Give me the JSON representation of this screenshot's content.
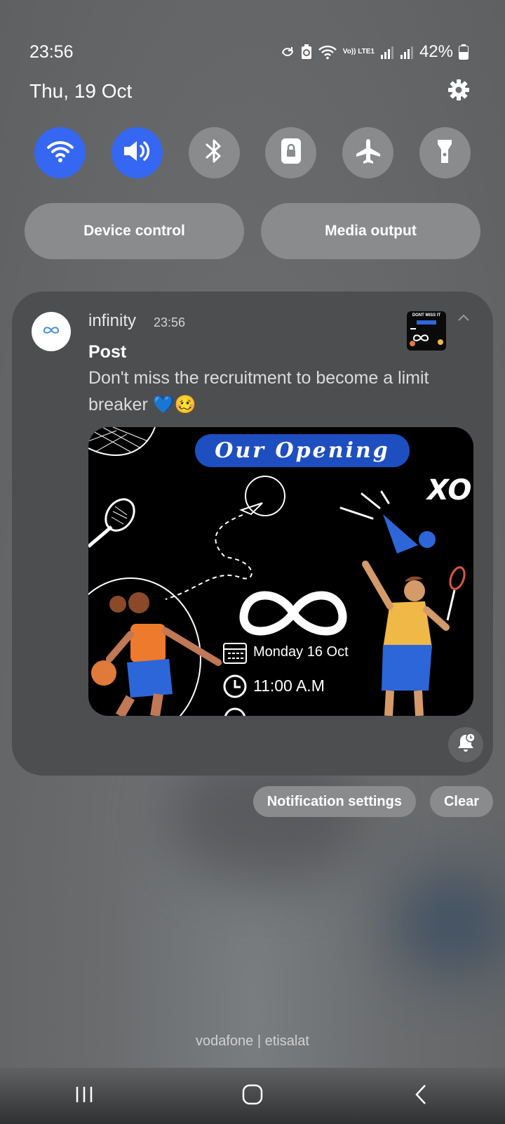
{
  "status_bar": {
    "time": "23:56",
    "battery": "42%",
    "icons": [
      "sync-icon",
      "battery-saver-icon",
      "wifi-icon",
      "volte-icon",
      "signal-icon",
      "signal-icon",
      "battery-icon"
    ],
    "volte_label": "Vo)) LTE1"
  },
  "quick_panel": {
    "date": "Thu, 19 Oct",
    "settings_icon": "gear-icon",
    "toggles": [
      {
        "name": "wifi",
        "icon": "wifi-icon",
        "on": true
      },
      {
        "name": "sound",
        "icon": "volume-icon",
        "on": true
      },
      {
        "name": "bluetooth",
        "icon": "bluetooth-icon",
        "on": false
      },
      {
        "name": "rotation-lock",
        "icon": "lock-icon",
        "on": false
      },
      {
        "name": "airplane-mode",
        "icon": "airplane-icon",
        "on": false
      },
      {
        "name": "flashlight",
        "icon": "flashlight-icon",
        "on": false
      }
    ],
    "device_control_label": "Device control",
    "media_output_label": "Media output"
  },
  "notification": {
    "app_name": "infinity",
    "time": "23:56",
    "title": "Post",
    "body": "Don't miss the recruitment to become a limit breaker 💙🥴",
    "thumbnail_text": "DONT MISS IT",
    "image": {
      "heading": "Our Opening",
      "date_text": "Monday 16 Oct",
      "time_text": "11:00 A.M"
    }
  },
  "actions": {
    "notification_settings": "Notification settings",
    "clear": "Clear"
  },
  "carrier": "vodafone | etisalat",
  "colors": {
    "accent": "#3567f2",
    "tile": "#8a8b8d",
    "card": "#4d4e50",
    "banner": "#1e4fc0"
  }
}
